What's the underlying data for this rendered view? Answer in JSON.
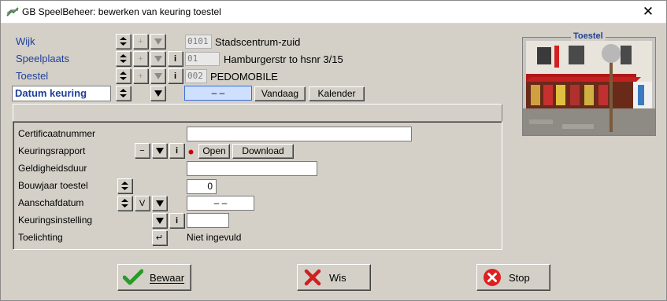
{
  "window": {
    "title": "GB SpeelBeheer: bewerken van keuring toestel",
    "close_glyph": "✕"
  },
  "header_fields": [
    {
      "label": "Wijk",
      "code": "0101",
      "value": "Stadscentrum-zuid"
    },
    {
      "label": "Speelplaats",
      "code": "01",
      "value": "Hamburgerstr to hsnr 3/15"
    },
    {
      "label": "Toestel",
      "code": "002",
      "value": "PEDOMOBILE"
    }
  ],
  "datum": {
    "label": "Datum keuring",
    "value": "–    –",
    "vandaag": "Vandaag",
    "kalender": "Kalender"
  },
  "form": {
    "certificaatnummer": {
      "label": "Certificaatnummer",
      "value": ""
    },
    "keuringsrapport": {
      "label": "Keuringsrapport",
      "open": "Open",
      "download": "Download"
    },
    "geldigheidsduur": {
      "label": "Geldigheidsduur",
      "value": ""
    },
    "bouwjaar": {
      "label": "Bouwjaar toestel",
      "value": "0"
    },
    "aanschafdatum": {
      "label": "Aanschafdatum",
      "v_label": "V",
      "value": "–    –"
    },
    "keuringsinstelling": {
      "label": "Keuringsinstelling",
      "value": ""
    },
    "toelichting": {
      "label": "Toelichting",
      "value": "Niet ingevuld"
    }
  },
  "photo": {
    "title": "Toestel"
  },
  "buttons": {
    "bewaar": "Bewaar",
    "wis": "Wis",
    "stop": "Stop"
  },
  "icons": {
    "info": "i",
    "minus": "−",
    "plus": "+",
    "enter": "↵"
  },
  "colors": {
    "label_blue": "#1f3f9a",
    "bullet_red": "#cc0000",
    "check_green": "#2a9a2a",
    "x_red": "#d02020",
    "stop_red": "#e02020"
  }
}
